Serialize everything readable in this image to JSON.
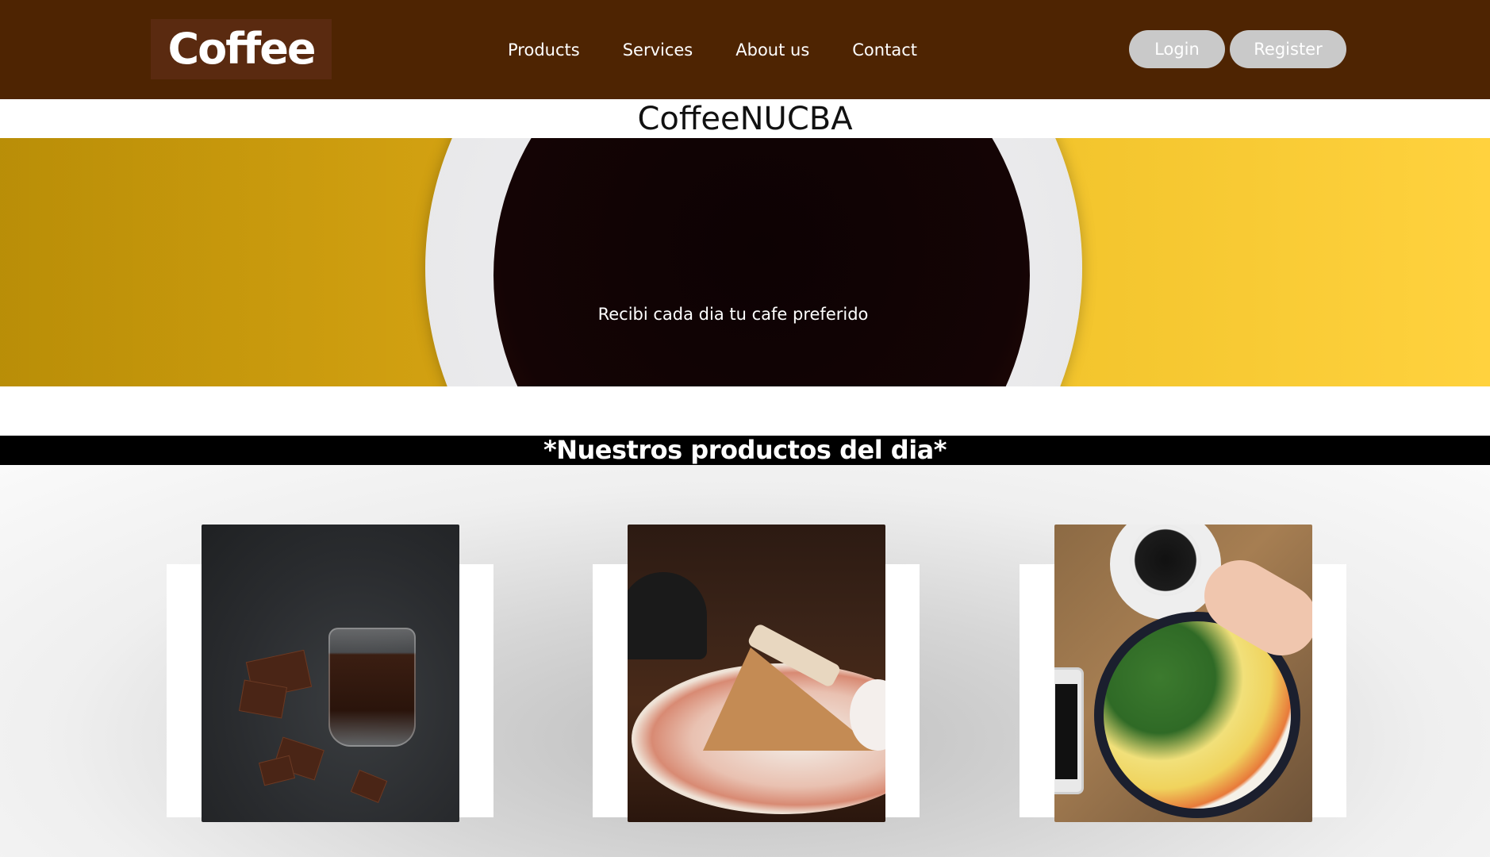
{
  "header": {
    "logo_text": "Coffee",
    "nav": [
      "Products",
      "Services",
      "About us",
      "Contact"
    ],
    "login_label": "Login",
    "register_label": "Register"
  },
  "site_title": "CoffeeNUCBA",
  "hero": {
    "tagline": "Recibi cada dia tu cafe preferido"
  },
  "products_section": {
    "title": "*Nuestros productos del dia*",
    "items": [
      {
        "image": "chocolate-and-drink-photo"
      },
      {
        "image": "cake-slice-photo"
      },
      {
        "image": "breakfast-bowl-photo"
      }
    ]
  },
  "colors": {
    "header_bg": "#4e2402",
    "button_bg": "#c9c9c9",
    "band_bg": "#000000",
    "hero_yellow": "#f2c42c"
  }
}
